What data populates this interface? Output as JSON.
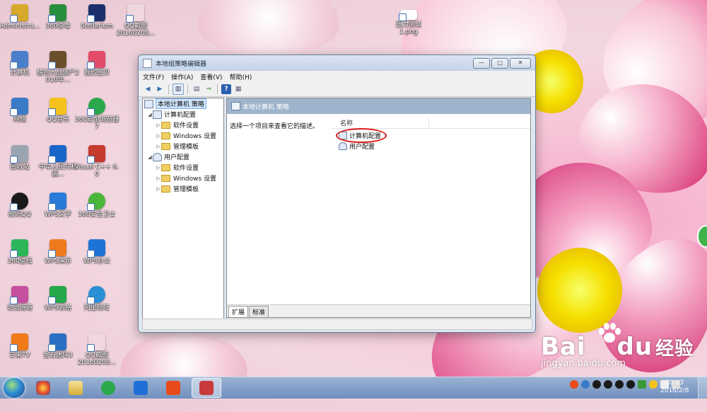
{
  "desktop": {
    "icons": [
      {
        "label": "Administra...",
        "color": "#d7a92a"
      },
      {
        "label": "360杀毒",
        "color": "#2a8f3c"
      },
      {
        "label": "Stellarium",
        "color": "#1c2f6c"
      },
      {
        "label": "QQ截图\n20160208...",
        "color": "#f0d7de"
      },
      {
        "label": "计算机",
        "color": "#4a7fc9"
      },
      {
        "label": "植物大战僵尸2010年...",
        "color": "#6b4f2a"
      },
      {
        "label": "我的宝贝",
        "color": "#e24c6a"
      },
      {
        "label": "网络",
        "color": "#3a7bc8"
      },
      {
        "label": "QQ音乐",
        "color": "#f5c21b"
      },
      {
        "label": "360安全浏览器7",
        "color": "#2aa84a"
      },
      {
        "label": "回收站",
        "color": "#9aa5b1"
      },
      {
        "label": "中华人民共和国...",
        "color": "#1b67c9"
      },
      {
        "label": "Visual C++ 6.0",
        "color": "#c73a2e"
      },
      {
        "label": "腾讯QQ",
        "color": "#1a1a1a"
      },
      {
        "label": "WPS文字",
        "color": "#2a7ad8"
      },
      {
        "label": "360安全卫士",
        "color": "#4ab63a"
      },
      {
        "label": "360壁纸",
        "color": "#2bb65a"
      },
      {
        "label": "WPS演示",
        "color": "#ef7a1e"
      },
      {
        "label": "WPS办公",
        "color": "#1e73d6"
      },
      {
        "label": "说说道道",
        "color": "#c64fa0"
      },
      {
        "label": "WPS表格",
        "color": "#25a94a"
      },
      {
        "label": "阿里旺旺",
        "color": "#2a8fd6"
      },
      {
        "label": "芒果TV",
        "color": "#f07a1a"
      },
      {
        "label": "宝石迷阵3",
        "color": "#2a6fc4"
      },
      {
        "label": "QQ截图\n20160208...",
        "color": "#f0d7de"
      },
      {
        "label": "压力测试\n1.png",
        "color": "#ffffff"
      }
    ]
  },
  "window": {
    "title": "本地组策略编辑器",
    "buttons": {
      "min": "—",
      "max": "□",
      "close": "✕"
    },
    "menu": [
      "文件(F)",
      "操作(A)",
      "查看(V)",
      "帮助(H)"
    ],
    "tree": {
      "root": "本地计算机 策略",
      "computer": "计算机配置",
      "computer_children": [
        "软件设置",
        "Windows 设置",
        "管理模板"
      ],
      "user": "用户配置",
      "user_children": [
        "软件设置",
        "Windows 设置",
        "管理模板"
      ]
    },
    "right": {
      "header": "本地计算机 策略",
      "description": "选择一个项目来查看它的描述。",
      "column": "名称",
      "items": [
        "计算机配置",
        "用户配置"
      ]
    },
    "tabs": [
      "扩展",
      "标准"
    ]
  },
  "taskbar": {
    "clock_time": "20:03",
    "clock_date": "2016/2/8"
  },
  "watermark": {
    "brand": "Bai",
    "brand2": "经验",
    "url": "jingyan.baidu.com"
  }
}
